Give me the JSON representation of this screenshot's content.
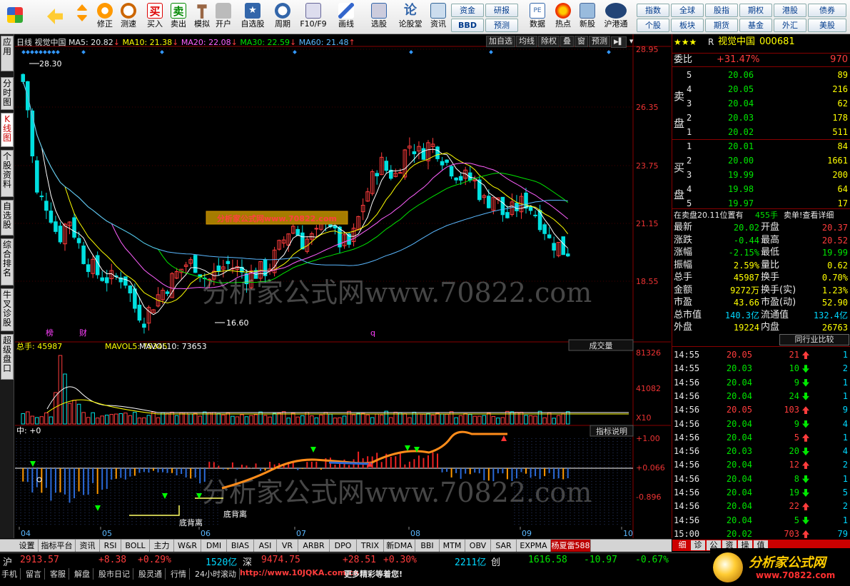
{
  "toolbar": {
    "buttons": [
      {
        "label": "",
        "icon": "grid-app-icon"
      },
      {
        "label": "",
        "icon": "back-arrow-icon"
      },
      {
        "label": "",
        "icon": "up-down-icon"
      },
      {
        "label": "修正",
        "icon": "refresh-icon"
      },
      {
        "label": "测速",
        "icon": "clock-icon"
      },
      {
        "label": "买入",
        "icon": "buy-icon"
      },
      {
        "label": "卖出",
        "icon": "sell-icon"
      },
      {
        "label": "模拟",
        "icon": "hammer-icon"
      },
      {
        "label": "开户",
        "icon": "lock-icon"
      },
      {
        "label": "自选股",
        "icon": "star-folder-icon"
      },
      {
        "label": "周期",
        "icon": "cycle-icon"
      },
      {
        "label": "F10/F9",
        "icon": "f10-icon"
      },
      {
        "label": "画线",
        "icon": "pen-icon"
      },
      {
        "label": "选股",
        "icon": "pick-icon"
      },
      {
        "label": "论股堂",
        "icon": "discuss-icon"
      },
      {
        "label": "资讯",
        "icon": "news-icon"
      },
      {
        "label": "数据",
        "icon": "pe-icon"
      },
      {
        "label": "热点",
        "icon": "hot-icon"
      },
      {
        "label": "新股",
        "icon": "new-stock-icon"
      },
      {
        "label": "沪港通",
        "icon": "shhk-icon"
      }
    ],
    "buy_char": "买",
    "sell_char": "卖",
    "lungu_char": "论",
    "mid_buttons": [
      [
        "资金",
        "BBD"
      ],
      [
        "研报",
        "预测"
      ]
    ],
    "right_buttons": [
      [
        "指数",
        "个股"
      ],
      [
        "全球",
        "板块"
      ],
      [
        "股指",
        "期货"
      ],
      [
        "期权",
        "基金"
      ],
      [
        "港股",
        "外汇"
      ],
      [
        "债券",
        "美股"
      ]
    ]
  },
  "left_tabs": [
    [
      "应",
      "用"
    ],
    [
      "分",
      "时",
      "图"
    ],
    [
      "K",
      "线",
      "图"
    ],
    [
      "个",
      "股",
      "资",
      "料"
    ],
    [
      "自",
      "选",
      "股"
    ],
    [
      "综",
      "合",
      "排",
      "名"
    ],
    [
      "牛",
      "叉",
      "诊",
      "股"
    ],
    [
      "超",
      "级",
      "盘",
      "口"
    ]
  ],
  "chart": {
    "header": {
      "period": "日线",
      "name": "视觉中国",
      "ma5": "MA5: 20.82",
      "ma10": "MA10: 21.38",
      "ma20": "MA20: 22.08",
      "ma30": "MA30: 22.59",
      "ma60": "MA60: 21.48",
      "tools": [
        "加自选",
        "均线",
        "除权",
        "叠",
        "窗",
        "预测"
      ]
    },
    "price_axis": [
      "28.95",
      "26.35",
      "23.75",
      "21.15",
      "18.55"
    ],
    "high_mark": "28.30",
    "low_mark": "16.60",
    "watermark_box": "分析家公式网www.70822.com",
    "watermark": "分析家公式网www.70822.com",
    "markers": [
      "榜",
      "财",
      "q"
    ],
    "vol_header": {
      "total": "总手: 45987",
      "mavol5": "MAVOL5: 75345",
      "mavol10": "MAVOL10: 73653"
    },
    "vol_dropdown": "成交量",
    "vol_axis": [
      "81326",
      "41082",
      "X10"
    ],
    "ind_header": "中: +0",
    "ind_button": "指标说明",
    "ind_axis": [
      "+1.00",
      "+0.066",
      "-0.896"
    ],
    "ind_labels": [
      "底背离",
      "底背离"
    ],
    "months": [
      "04",
      "05",
      "06",
      "07",
      "08",
      "09",
      "10"
    ]
  },
  "chart_data": {
    "type": "candlestick",
    "title": "视觉中国",
    "x": [
      "04",
      "05",
      "06",
      "07",
      "08",
      "09",
      "10"
    ],
    "y_range": [
      16.6,
      28.95
    ],
    "high": 28.3,
    "low": 16.6,
    "ma": {
      "MA5": 20.82,
      "MA10": 21.38,
      "MA20": 22.08,
      "MA30": 22.59,
      "MA60": 21.48
    },
    "volume": {
      "total": 45987,
      "MAVOL5": 75345,
      "MAVOL10": 73653,
      "axis": [
        81326,
        41082
      ]
    }
  },
  "right": {
    "stars": "★★★",
    "r": "R",
    "name": "视觉中国",
    "code": "000681",
    "weibi_label": "委比",
    "weibi": "+31.47%",
    "weicha": "970",
    "sell": [
      [
        "5",
        "20.06",
        "89"
      ],
      [
        "4",
        "20.05",
        "216"
      ],
      [
        "3",
        "20.04",
        "62"
      ],
      [
        "2",
        "20.03",
        "178"
      ],
      [
        "1",
        "20.02",
        "511"
      ]
    ],
    "buy": [
      [
        "1",
        "20.01",
        "84"
      ],
      [
        "2",
        "20.00",
        "1661"
      ],
      [
        "3",
        "19.99",
        "200"
      ],
      [
        "4",
        "19.98",
        "64"
      ],
      [
        "5",
        "19.97",
        "17"
      ]
    ],
    "sell_side": [
      "卖",
      "盘"
    ],
    "buy_side": [
      "买",
      "盘"
    ],
    "notice": "在卖盘20.11位置有",
    "notice_qty": "455手",
    "notice_tail": "卖单!查看详细",
    "quote": [
      [
        "最新",
        "20.02",
        "开盘",
        "20.37"
      ],
      [
        "涨跌",
        "-0.44",
        "最高",
        "20.52"
      ],
      [
        "涨幅",
        "-2.15%",
        "最低",
        "19.99"
      ],
      [
        "振幅",
        "2.59%",
        "量比",
        "0.62"
      ],
      [
        "总手",
        "45987",
        "换手",
        "0.70%"
      ],
      [
        "金额",
        "9272万",
        "换手(实)",
        "1.23%"
      ],
      [
        "市盈",
        "43.66",
        "市盈(动)",
        "52.90"
      ],
      [
        "总市值",
        "140.3亿",
        "流通值",
        "132.4亿"
      ],
      [
        "外盘",
        "19224",
        "内盘",
        "26763"
      ]
    ],
    "compare_btn": "同行业比较",
    "ticks": [
      [
        "14:55",
        "20.05",
        "21",
        "up",
        "1"
      ],
      [
        "14:55",
        "20.03",
        "10",
        "dn",
        "2"
      ],
      [
        "14:56",
        "20.04",
        "9",
        "dn",
        "1"
      ],
      [
        "14:56",
        "20.04",
        "24",
        "dn",
        "1"
      ],
      [
        "14:56",
        "20.05",
        "103",
        "up",
        "9"
      ],
      [
        "14:56",
        "20.04",
        "9",
        "dn",
        "4"
      ],
      [
        "14:56",
        "20.04",
        "5",
        "up",
        "1"
      ],
      [
        "14:56",
        "20.03",
        "20",
        "dn",
        "4"
      ],
      [
        "14:56",
        "20.04",
        "12",
        "up",
        "2"
      ],
      [
        "14:56",
        "20.04",
        "8",
        "dn",
        "1"
      ],
      [
        "14:56",
        "20.04",
        "19",
        "dn",
        "5"
      ],
      [
        "14:56",
        "20.04",
        "22",
        "up",
        "2"
      ],
      [
        "14:56",
        "20.04",
        "5",
        "dn",
        "1"
      ],
      [
        "15:00",
        "20.02",
        "703",
        "up",
        "79"
      ]
    ],
    "bottom_tabs": [
      "细",
      "诊",
      "公",
      "资",
      "操",
      "值"
    ]
  },
  "bottom_tabs": [
    "设置",
    "指标平台",
    "资讯",
    "RSI",
    "BOLL",
    "主力",
    "W&R",
    "DMI",
    "BIAS",
    "ASI",
    "VR",
    "ARBR",
    "DPO",
    "TRIX",
    "新DMA",
    "BBI",
    "MTM",
    "OBV",
    "SAR",
    "EXPMA",
    "杨夏雷588"
  ],
  "status": {
    "sh": "沪",
    "sh_val": "2913.57",
    "sh_chg": "+8.38",
    "sh_pct": "+0.29%",
    "sh_amt": "1520亿",
    "sz": "深",
    "sz_val": "9474.75",
    "sz_chg": "+28.51",
    "sz_pct": "+0.30%",
    "sz_amt": "2211亿",
    "cy": "创",
    "cy_val": "1616.58",
    "cy_chg": "-10.97",
    "cy_pct": "-0.67%"
  },
  "status2": {
    "items": [
      "手机",
      "留言",
      "客服",
      "解盘",
      "股市日记",
      "股灵通",
      "行情",
      "24小时滚动"
    ],
    "url": "http://www.10JQKA.com.cn",
    "more": "更多精彩等着您!",
    "logo": "分析家公式网",
    "logo_url": "www.70822.com"
  },
  "colors": {
    "up": "#ff3c3c",
    "down": "#00e0e0",
    "ma5": "#ffffff",
    "ma10": "#ffff00",
    "ma20": "#ff60ff",
    "ma30": "#00e600",
    "ma60": "#5ab8ff"
  }
}
